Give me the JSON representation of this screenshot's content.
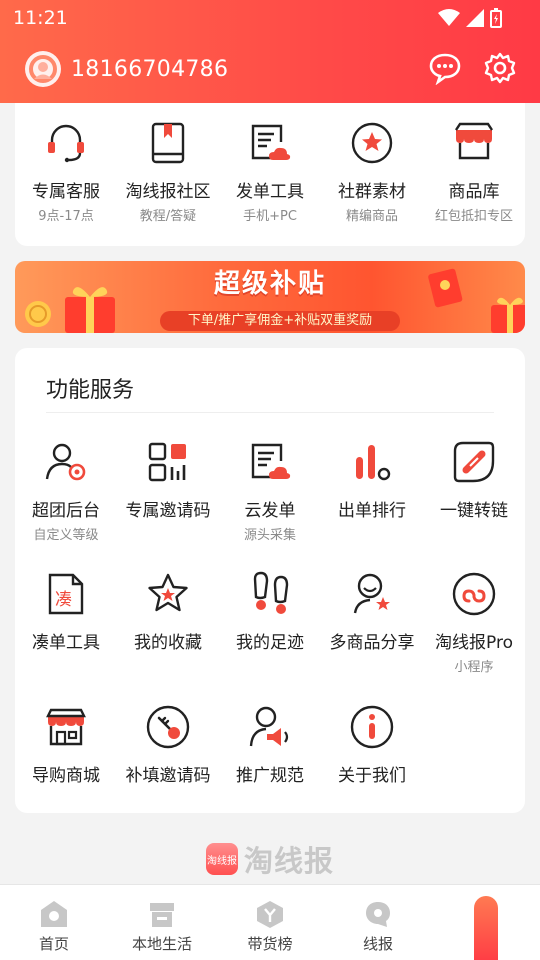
{
  "status_bar": {
    "time": "11:21"
  },
  "header": {
    "phone": "18166704786"
  },
  "top_grid": [
    {
      "label": "专属客服",
      "sub": "9点-17点",
      "icon": "headset-icon"
    },
    {
      "label": "淘线报社区",
      "sub": "教程/答疑",
      "icon": "book-icon"
    },
    {
      "label": "发单工具",
      "sub": "手机+PC",
      "icon": "cloud-doc-icon"
    },
    {
      "label": "社群素材",
      "sub": "精编商品",
      "icon": "star-circle-icon"
    },
    {
      "label": "商品库",
      "sub": "红包抵扣专区",
      "icon": "store-icon"
    }
  ],
  "banner": {
    "title": "超级补贴",
    "subtitle": "下单/推广享佣金+补贴双重奖励"
  },
  "services": {
    "title": "功能服务",
    "rows": [
      [
        {
          "label": "超团后台",
          "sub": "自定义等级",
          "icon": "user-gear-icon"
        },
        {
          "label": "专属邀请码",
          "sub": "",
          "icon": "qrcode-icon"
        },
        {
          "label": "云发单",
          "sub": "源头采集",
          "icon": "cloud-doc-icon"
        },
        {
          "label": "出单排行",
          "sub": "",
          "icon": "bar-rank-icon"
        },
        {
          "label": "一键转链",
          "sub": "",
          "icon": "link-icon"
        }
      ],
      [
        {
          "label": "凑单工具",
          "sub": "",
          "icon": "doc-cou-icon"
        },
        {
          "label": "我的收藏",
          "sub": "",
          "icon": "star-icon"
        },
        {
          "label": "我的足迹",
          "sub": "",
          "icon": "footprint-icon"
        },
        {
          "label": "多商品分享",
          "sub": "",
          "icon": "share-user-icon"
        },
        {
          "label": "淘线报Pro",
          "sub": "小程序",
          "icon": "miniapp-icon"
        }
      ],
      [
        {
          "label": "导购商城",
          "sub": "",
          "icon": "shop-icon"
        },
        {
          "label": "补填邀请码",
          "sub": "",
          "icon": "key-icon"
        },
        {
          "label": "推广规范",
          "sub": "",
          "icon": "megaphone-user-icon"
        },
        {
          "label": "关于我们",
          "sub": "",
          "icon": "info-icon"
        }
      ]
    ]
  },
  "brand": {
    "logo_text": "淘线报",
    "name": "淘线报"
  },
  "tabbar": [
    {
      "label": "首页",
      "icon": "home-icon"
    },
    {
      "label": "本地生活",
      "icon": "store-tab-icon"
    },
    {
      "label": "带货榜",
      "icon": "rank-tab-icon"
    },
    {
      "label": "线报",
      "icon": "chat-tab-icon"
    },
    {
      "label": "",
      "icon": "me-tab-icon"
    }
  ],
  "colors": {
    "accent": "#ff4a48",
    "icon_red": "#f04a3c"
  }
}
